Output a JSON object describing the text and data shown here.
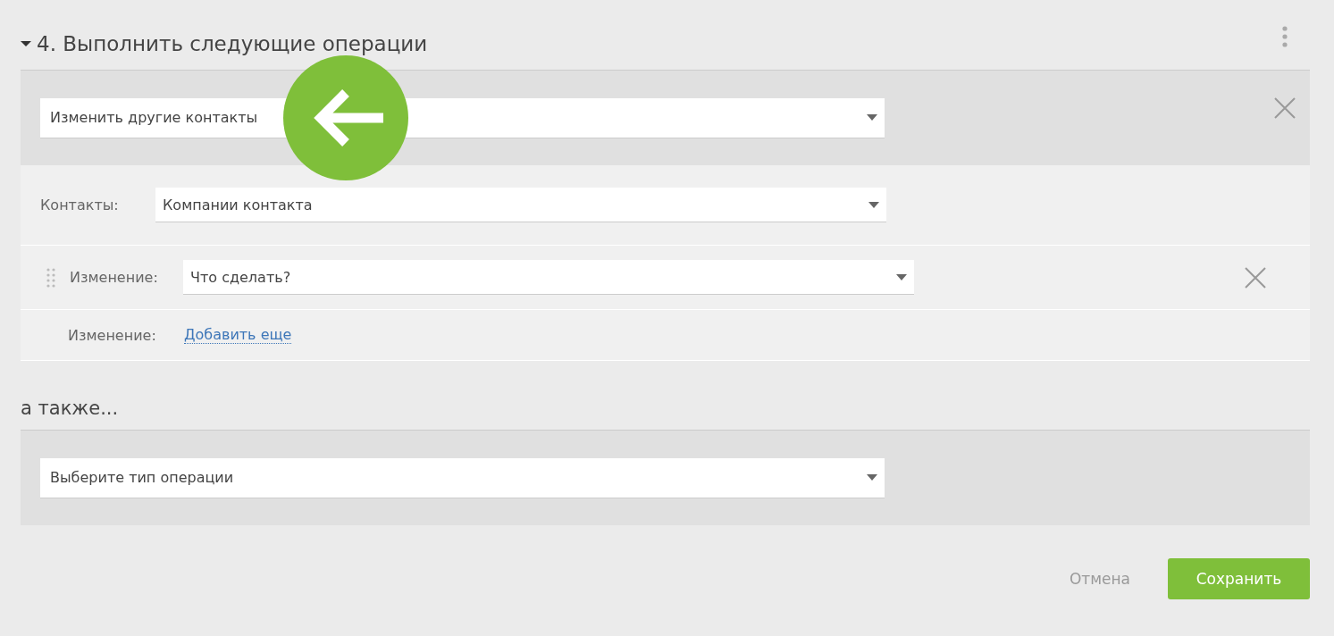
{
  "section": {
    "title": "4. Выполнить следующие операции",
    "expanded": true
  },
  "operation": {
    "value": "Изменить другие контакты"
  },
  "contacts": {
    "label": "Контакты:",
    "value": "Компании контакта"
  },
  "changes": [
    {
      "label": "Изменение:",
      "value": "Что сделать?"
    }
  ],
  "add_change": {
    "label": "Изменение:",
    "link": "Добавить еще"
  },
  "also": {
    "title": "а также...",
    "value": "Выберите тип операции"
  },
  "buttons": {
    "cancel": "Отмена",
    "save": "Сохранить"
  }
}
